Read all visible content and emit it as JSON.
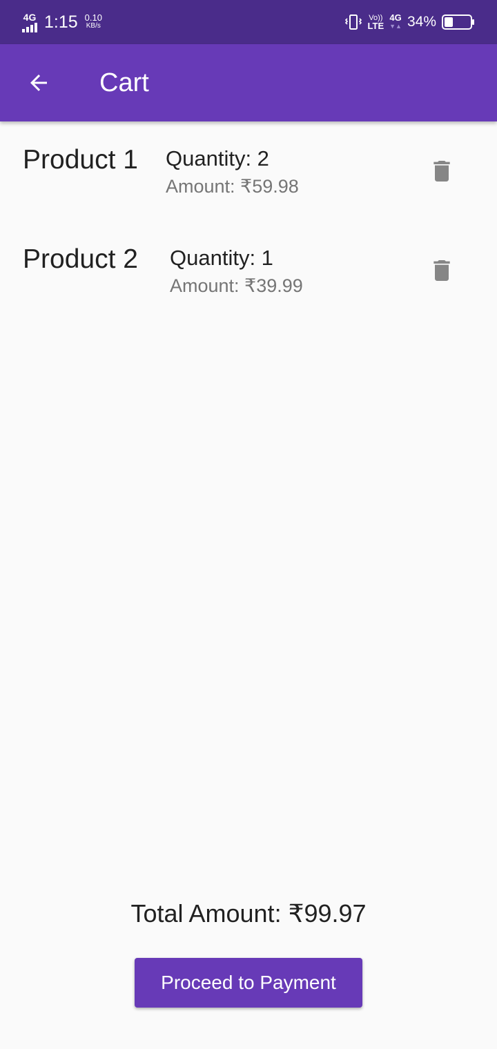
{
  "status_bar": {
    "network_left": "4G",
    "time": "1:15",
    "speed_value": "0.10",
    "speed_unit": "KB/s",
    "volte_top": "Vo))",
    "volte_bottom": "LTE",
    "network_right": "4G",
    "battery_percent": "34%",
    "battery_level": 0.34,
    "icons": [
      "signal-icon",
      "vibrate-icon",
      "battery-icon"
    ]
  },
  "app_bar": {
    "title": "Cart",
    "back_icon": "arrow-back-icon"
  },
  "cart": {
    "items": [
      {
        "name": "Product 1",
        "quantity": "Quantity: 2",
        "amount": "Amount: ₹59.98",
        "delete_icon": "delete-icon"
      },
      {
        "name": "Product 2",
        "quantity": "Quantity: 1",
        "amount": "Amount: ₹39.99",
        "delete_icon": "delete-icon"
      }
    ]
  },
  "footer": {
    "total": "Total Amount: ₹99.97",
    "proceed_label": "Proceed to Payment"
  },
  "colors": {
    "status_bar": "#4a2c8a",
    "primary": "#673ab7",
    "background": "#fafafa",
    "text_primary": "#212121",
    "text_secondary": "#757575",
    "icon_gray": "#868686"
  }
}
